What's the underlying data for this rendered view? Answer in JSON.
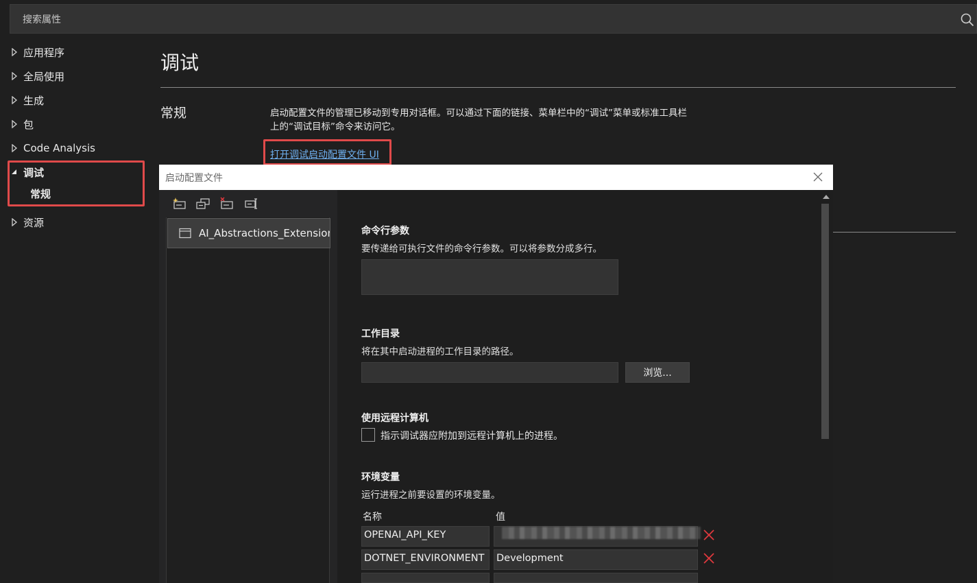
{
  "search": {
    "placeholder": "搜索属性"
  },
  "sidebar": {
    "items": [
      {
        "label": "应用程序"
      },
      {
        "label": "全局使用"
      },
      {
        "label": "生成"
      },
      {
        "label": "包"
      },
      {
        "label": "Code Analysis"
      },
      {
        "label": "调试",
        "expanded": true
      },
      {
        "label": "常规",
        "selected": true
      },
      {
        "label": "资源"
      }
    ]
  },
  "main": {
    "title": "调试",
    "section": "常规",
    "description": "启动配置文件的管理已移动到专用对话框。可以通过下面的链接、菜单栏中的“调试”菜单或标准工具栏上的“调试目标”命令来访问它。",
    "link": "打开调试启动配置文件 UI"
  },
  "dialog": {
    "title": "启动配置文件",
    "toolbar": [
      "new-profile-icon",
      "copy-profile-icon",
      "delete-profile-icon",
      "rename-profile-icon"
    ],
    "profiles": [
      "AI_Abstractions_Extension"
    ],
    "cmdargs": {
      "label": "命令行参数",
      "help": "要传递给可执行文件的命令行参数。可以将参数分成多行。",
      "value": ""
    },
    "workdir": {
      "label": "工作目录",
      "help": "将在其中启动进程的工作目录的路径。",
      "value": "",
      "browse": "浏览..."
    },
    "remote": {
      "label": "使用远程计算机",
      "checkbox": "指示调试器应附加到远程计算机上的进程。",
      "checked": false
    },
    "env": {
      "label": "环境变量",
      "help": "运行进程之前要设置的环境变量。",
      "col_name": "名称",
      "col_value": "值",
      "rows": [
        {
          "name": "OPENAI_API_KEY",
          "value": ""
        },
        {
          "name": "DOTNET_ENVIRONMENT",
          "value": "Development"
        }
      ]
    }
  },
  "colors": {
    "highlight": "#e04a4a",
    "link": "#6fb0f0",
    "delete": "#e0393e"
  }
}
